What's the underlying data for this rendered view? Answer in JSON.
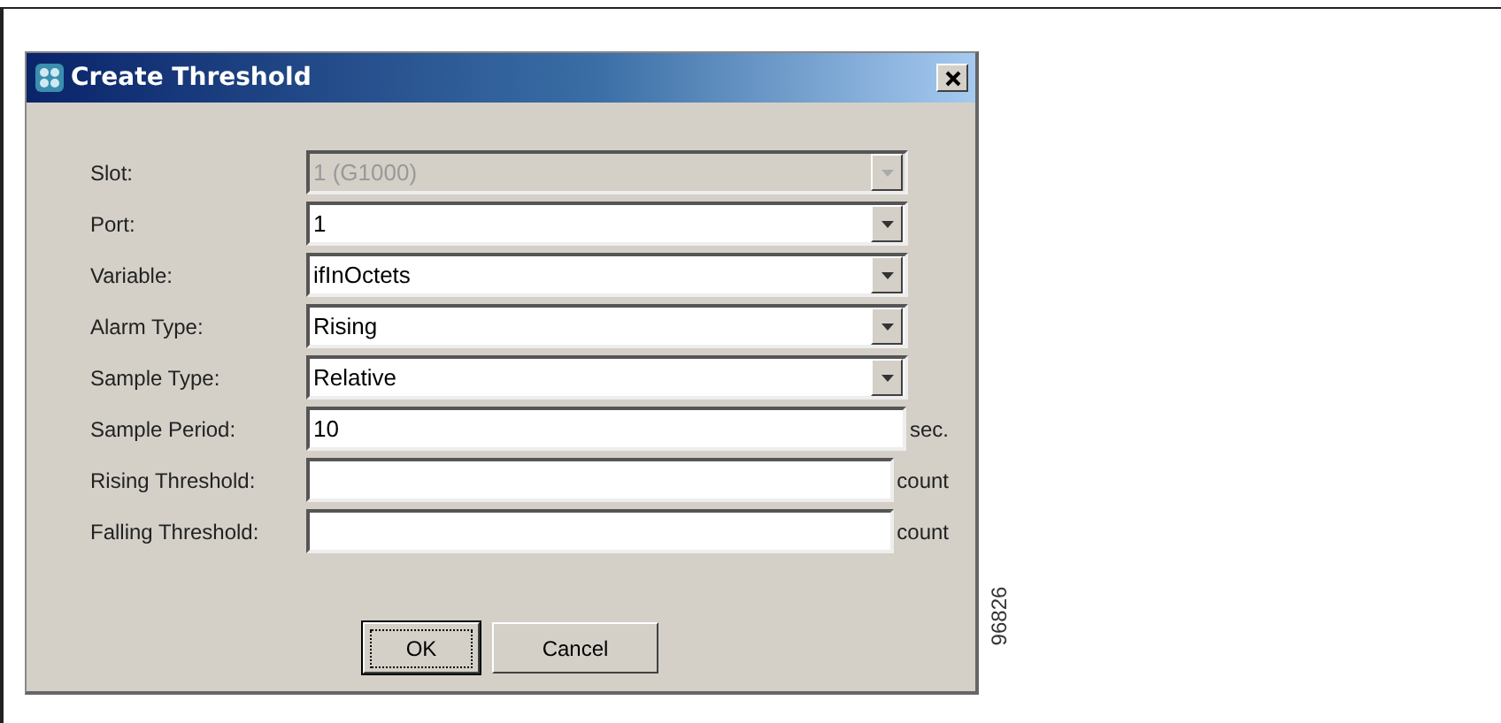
{
  "dialog": {
    "title": "Create Threshold",
    "fields": [
      {
        "label": "Slot:",
        "kind": "dropdown",
        "value": "1 (G1000)",
        "disabled": true
      },
      {
        "label": "Port:",
        "kind": "dropdown",
        "value": "1",
        "disabled": false
      },
      {
        "label": "Variable:",
        "kind": "dropdown",
        "value": "ifInOctets",
        "disabled": false
      },
      {
        "label": "Alarm Type:",
        "kind": "dropdown",
        "value": "Rising",
        "disabled": false
      },
      {
        "label": "Sample Type:",
        "kind": "dropdown",
        "value": "Relative",
        "disabled": false
      },
      {
        "label": "Sample Period:",
        "kind": "text",
        "value": "10",
        "unit": "sec."
      },
      {
        "label": "Rising Threshold:",
        "kind": "text",
        "unit": "count"
      },
      {
        "label": "Falling Threshold:",
        "kind": "text",
        "unit": "count"
      }
    ],
    "buttons": [
      {
        "label": "OK",
        "focused": true
      },
      {
        "label": "Cancel",
        "focused": false
      }
    ]
  },
  "figure_id": "96826"
}
